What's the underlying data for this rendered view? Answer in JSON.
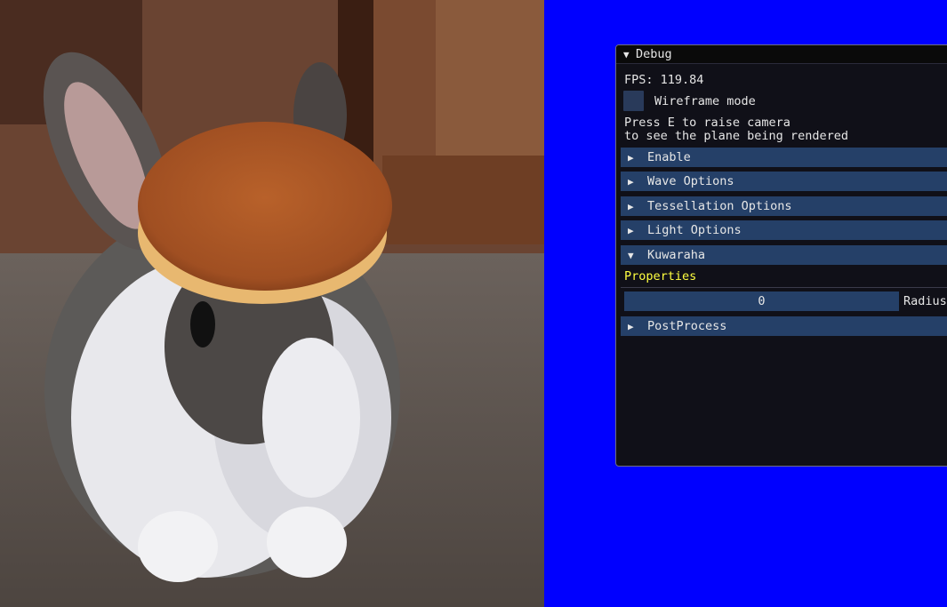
{
  "debug_window": {
    "title": "Debug",
    "fps_text": "FPS: 119.84",
    "wireframe": {
      "label": "Wireframe mode",
      "checked": false
    },
    "info_line1": "Press E to raise camera",
    "info_line2": "to see the plane being rendered",
    "sections": {
      "enable": "Enable",
      "wave": "Wave Options",
      "tessellation": "Tessellation Options",
      "light": "Light Options",
      "kuwahara": "Kuwaraha",
      "postprocess": "PostProcess"
    },
    "kuwahara_panel": {
      "properties_label": "Properties",
      "radius_value": "0",
      "radius_label": "Radius"
    }
  },
  "icons": {
    "expanded": "triangle-down-icon",
    "collapsed": "triangle-right-icon"
  },
  "colors": {
    "background": "#0000ff",
    "header": "#254068",
    "properties_text": "#ffff40"
  }
}
